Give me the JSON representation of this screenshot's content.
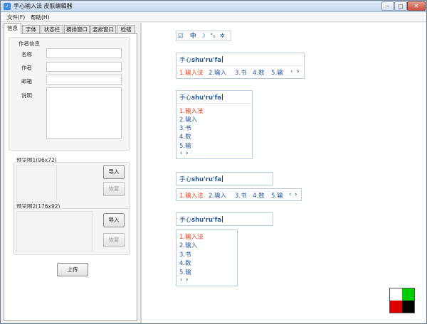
{
  "window": {
    "title": "手心输入法 皮肤编辑器",
    "min_glyph": "–",
    "max_glyph": "□",
    "close_glyph": "✕",
    "app_icon_glyph": "✓"
  },
  "menu": {
    "file": "文件(F)",
    "help": "帮助(H)"
  },
  "tabs": [
    "信息",
    "字体",
    "状态栏",
    "横排窗口",
    "竖排窗口",
    "检错"
  ],
  "author": {
    "group_title": "作者信息",
    "name_label": "名称",
    "author_label": "作者",
    "email_label": "邮箱",
    "desc_label": "说明",
    "name_value": "",
    "author_value": "",
    "email_value": "",
    "desc_value": ""
  },
  "preview1": {
    "title": "预览图1(96x72)",
    "import": "导入",
    "restore": "恢复"
  },
  "preview2": {
    "title": "预览图2(176x92)",
    "import": "导入",
    "restore": "恢复"
  },
  "upload_label": "上传",
  "toolbar": {
    "check": "☑",
    "lang": "中",
    "moon": "☽",
    "dots": "°₀",
    "gear": "✲"
  },
  "composition": {
    "prefix": "手心",
    "pinyin": "shu'ru'fa"
  },
  "candidates": [
    "1.输入法",
    "2.输入",
    "3.书",
    "4.数",
    "5.输"
  ],
  "pager": {
    "prev": "‹",
    "next": "›"
  },
  "swatch": {
    "top_left": "#ffffff",
    "top_right": "#00cc00",
    "bottom_left": "#dd0000",
    "bottom_right": "#000000"
  }
}
